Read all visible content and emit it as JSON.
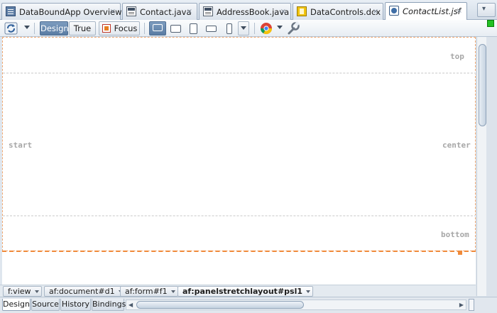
{
  "tabs": [
    {
      "label": "DataBoundApp Overview",
      "icon": "form-icon",
      "active": false
    },
    {
      "label": "Contact.java",
      "icon": "java-file-icon",
      "active": false
    },
    {
      "label": "AddressBook.java",
      "icon": "java-file-icon",
      "active": false
    },
    {
      "label": "DataControls.dcx",
      "icon": "data-controls-icon",
      "active": false
    },
    {
      "label": "ContactList.jsf",
      "icon": "jsf-file-icon",
      "active": true
    }
  ],
  "tab_close_glyph": "×",
  "tab_menu_glyph": "▾",
  "toolbar": {
    "design_label": "Design",
    "true_label": "True",
    "focus_label": "Focus",
    "selected_mode": "Design",
    "selected_device": "desktop"
  },
  "canvas": {
    "top_label": "top",
    "start_label": "start",
    "center_label": "center",
    "bottom_label": "bottom",
    "highlight_color": "#f08a3a"
  },
  "breadcrumb": [
    "f:view",
    "af:document#d1",
    "af:form#f1",
    "af:panelstretchlayout#psl1"
  ],
  "bottom_tabs": [
    {
      "label": "Design",
      "active": true
    },
    {
      "label": "Source",
      "active": false
    },
    {
      "label": "History",
      "active": false
    },
    {
      "label": "Bindings",
      "active": false
    }
  ],
  "icons": {
    "refresh": "refresh-icon",
    "browser": "chrome-browser-icon",
    "wrench": "wrench-icon",
    "status": "green-status-icon"
  }
}
